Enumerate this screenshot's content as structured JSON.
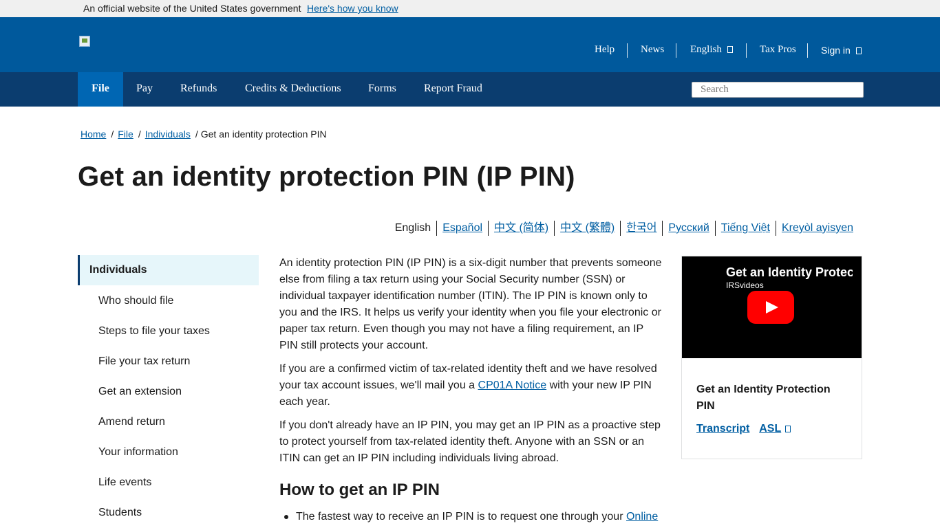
{
  "gov_banner": {
    "text": "An official website of the United States government",
    "link": "Here's how you know"
  },
  "utility_nav": {
    "help": "Help",
    "news": "News",
    "language": "English",
    "tax_pros": "Tax Pros",
    "sign_in": "Sign in"
  },
  "main_nav": {
    "items": [
      "File",
      "Pay",
      "Refunds",
      "Credits & Deductions",
      "Forms",
      "Report Fraud"
    ],
    "active": "File",
    "search_placeholder": "Search"
  },
  "breadcrumb": {
    "items": [
      "Home",
      "File",
      "Individuals"
    ],
    "current": "Get an identity protection PIN"
  },
  "page_title": "Get an identity protection PIN (IP PIN)",
  "languages": {
    "current": "English",
    "others": [
      "Español",
      "中文 (简体)",
      "中文 (繁體)",
      "한국어",
      "Русский",
      "Tiếng Việt",
      "Kreyòl ayisyen"
    ]
  },
  "sidebar": {
    "heading": "Individuals",
    "items": [
      "Who should file",
      "Steps to file your taxes",
      "File your tax return",
      "Get an extension",
      "Amend return",
      "Your information",
      "Life events",
      "Students"
    ]
  },
  "content": {
    "para1": "An identity protection PIN (IP PIN) is a six-digit number that prevents someone else from filing a tax return using your Social Security number (SSN) or individual taxpayer identification number (ITIN). The IP PIN is known only to you and the IRS. It helps us verify your identity when you file your electronic or paper tax return. Even though you may not have a filing requirement, an IP PIN still protects your account.",
    "para2_before": "If you are a confirmed victim of tax-related identity theft and we have resolved your tax account issues, we'll mail you a ",
    "para2_link": "CP01A Notice",
    "para2_after": " with your new IP PIN each year.",
    "para3": "If you don't already have an IP PIN, you may get an IP PIN as a proactive step to protect yourself from tax-related identity theft. Anyone with an SSN or an ITIN can get an IP PIN including individuals living abroad.",
    "heading": "How to get an IP PIN",
    "bullet1_before": "The fastest way to receive an IP PIN is to request one through your ",
    "bullet1_link": "Online"
  },
  "video_card": {
    "video_title": "Get an Identity Protec",
    "video_channel": "IRSvideos",
    "title": "Get an Identity Protection PIN",
    "transcript": "Transcript",
    "asl": "ASL"
  },
  "colors": {
    "header_blue": "#00599c",
    "nav_navy": "#0b3d6f",
    "nav_active": "#0066b3",
    "link": "#005ea2",
    "sidebar_active_bg": "#e6f6fa"
  }
}
